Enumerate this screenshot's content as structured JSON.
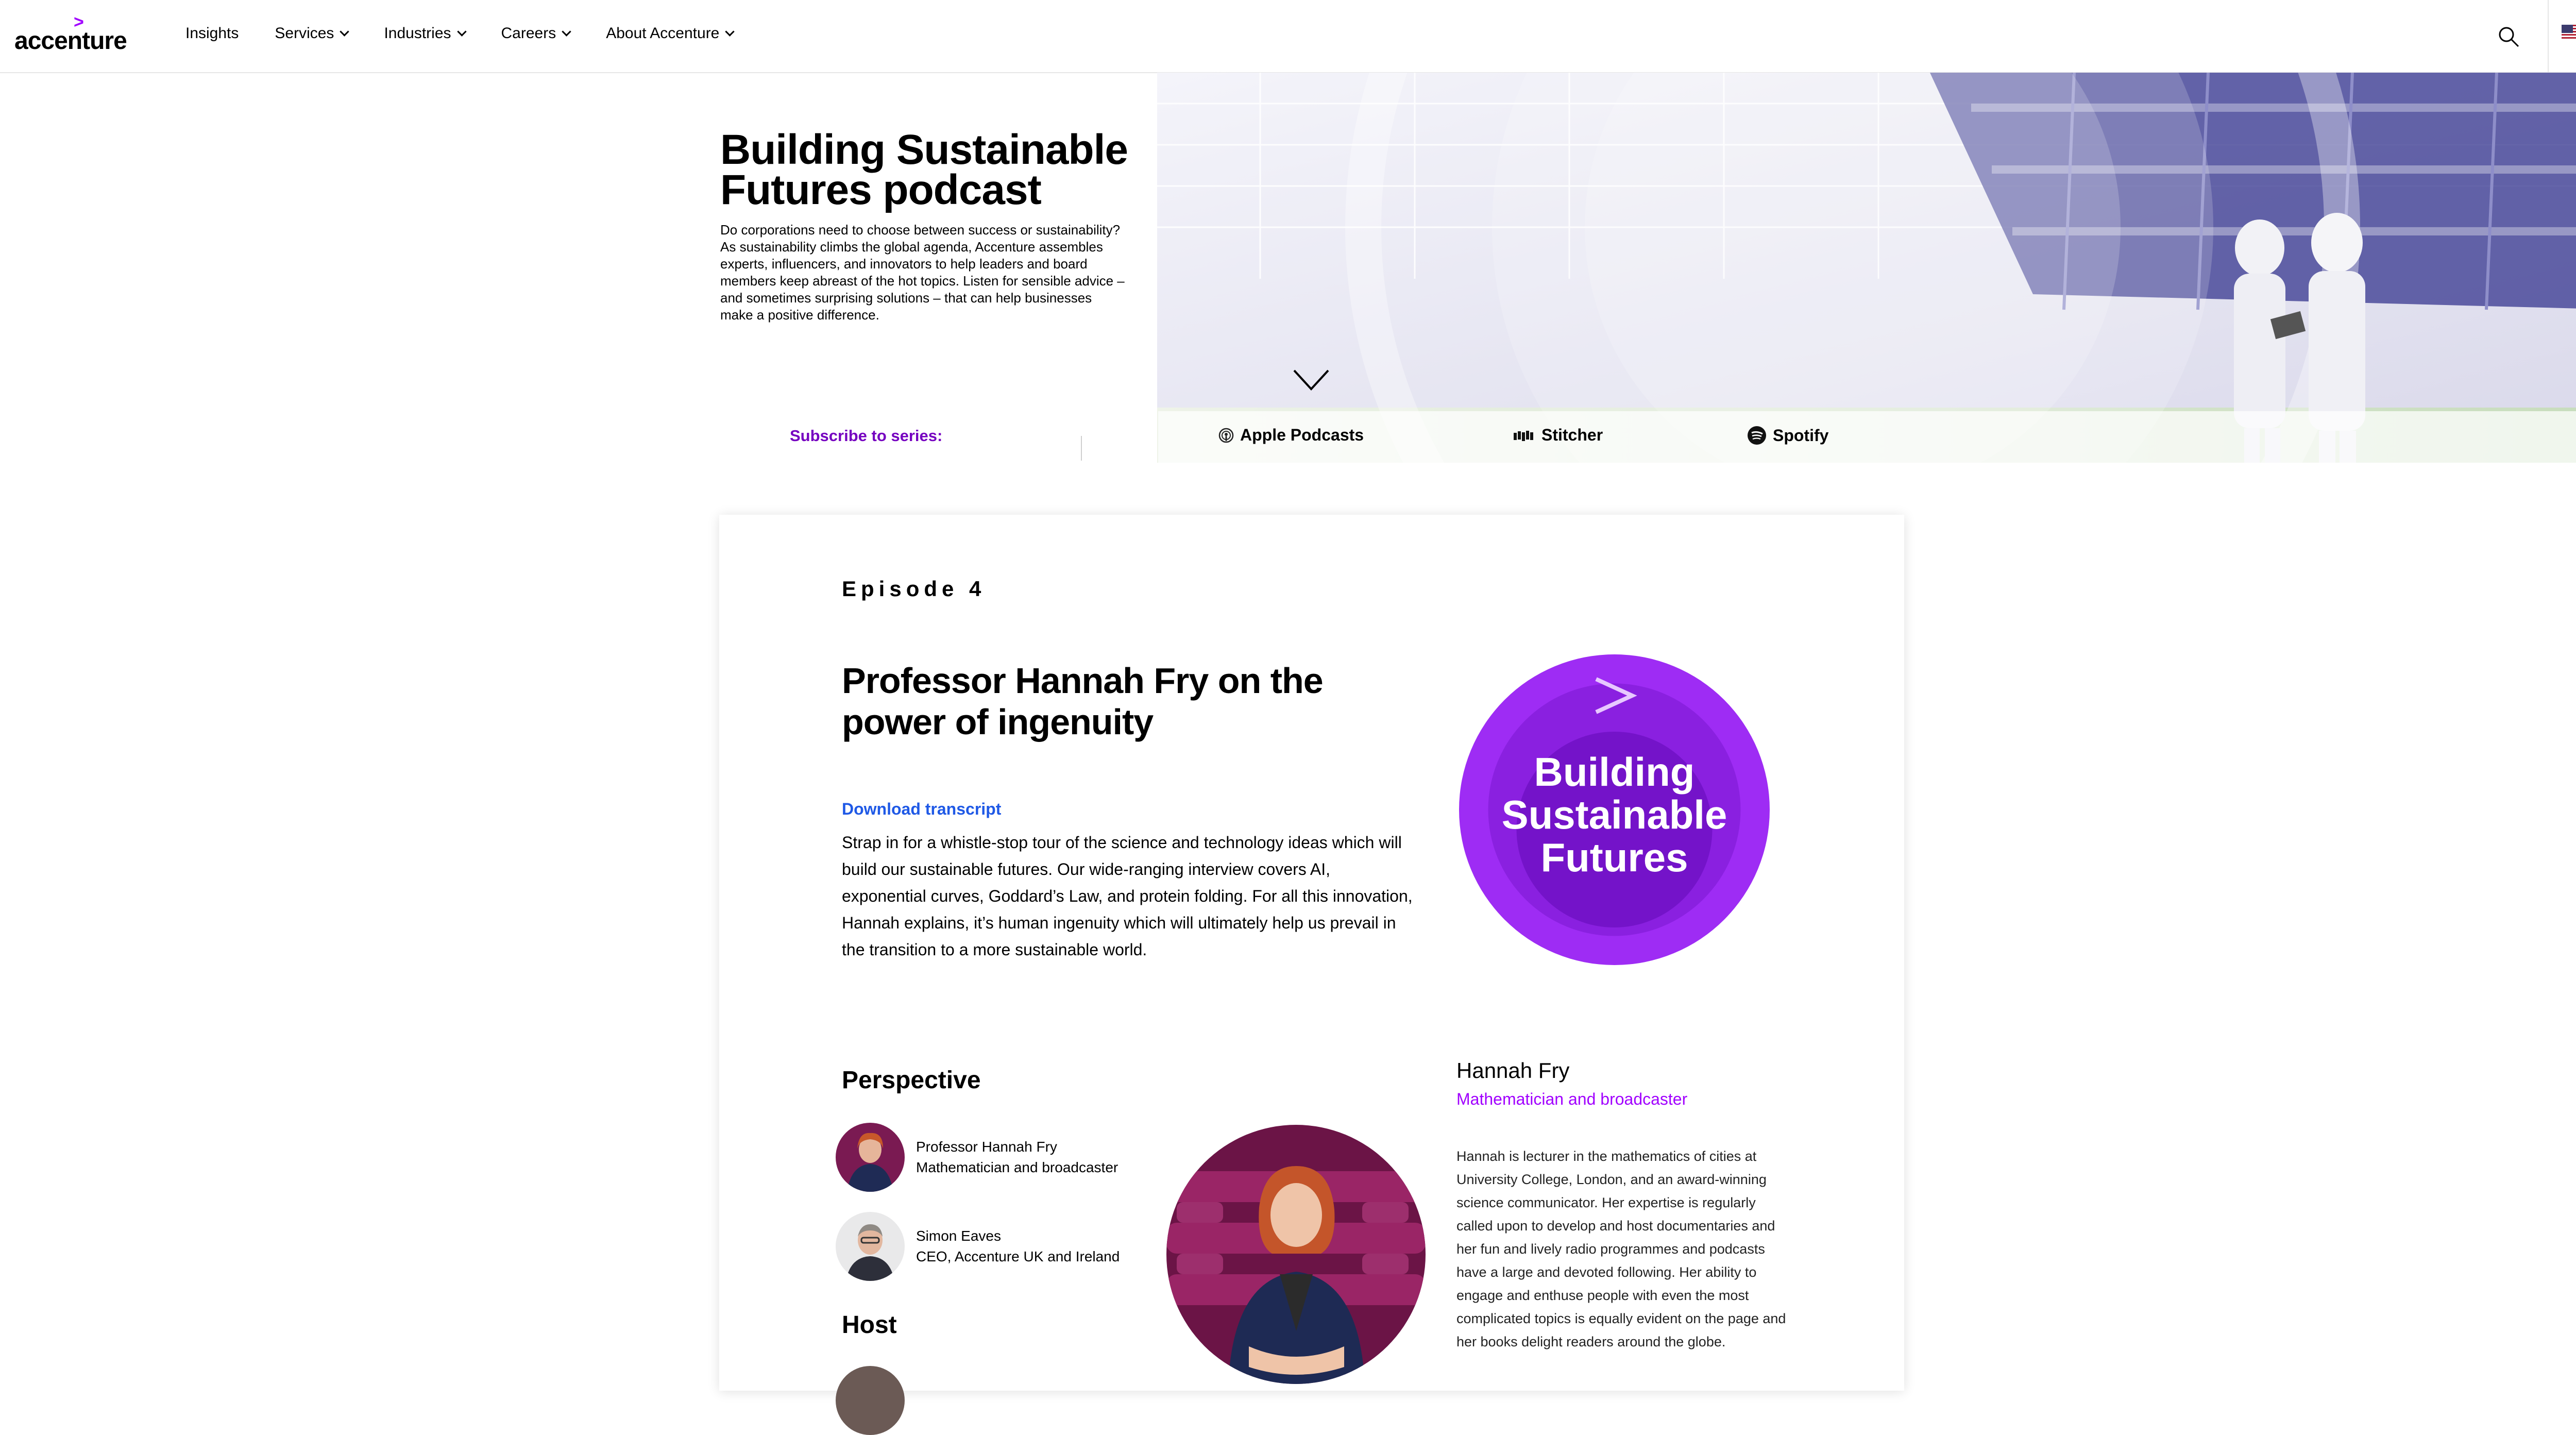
{
  "nav": {
    "logo_mark": ">",
    "logo_text": "accenture",
    "items": [
      "Insights",
      "Services",
      "Industries",
      "Careers",
      "About Accenture"
    ]
  },
  "hero": {
    "title": "Building Sustainable Futures podcast",
    "description": "Do corporations need to choose between success or sustainability? As sustainability climbs the global agenda, Accenture assembles experts, influencers, and innovators to help leaders and board members keep abreast of the hot topics. Listen for sensible advice – and sometimes surprising solutions – that can help businesses make a positive difference."
  },
  "subscribe": {
    "label": "Subscribe to series:",
    "platforms": [
      "Apple Podcasts",
      "Stitcher",
      "Spotify"
    ]
  },
  "episode": {
    "number": "Episode 4",
    "title": "Professor Hannah Fry on the power of ingenuity",
    "download_label": "Download transcript",
    "description": "Strap in for a whistle-stop tour of the science and technology ideas which will build our sustainable futures. Our wide-ranging interview covers AI, exponential curves, Goddard’s Law, and protein folding. For all this innovation, Hannah explains, it’s human ingenuity which will ultimately help us prevail in the transition to a more sustainable world.",
    "badge_lines": [
      "Building",
      "Sustainable",
      "Futures"
    ]
  },
  "perspective": {
    "heading": "Perspective",
    "people": [
      {
        "name": "Professor Hannah Fry",
        "role": "Mathematician and broadcaster"
      },
      {
        "name": "Simon Eaves",
        "role": "CEO, Accenture UK and Ireland"
      }
    ]
  },
  "host": {
    "heading": "Host"
  },
  "bio": {
    "name": "Hannah Fry",
    "role": "Mathematician and broadcaster",
    "text": "Hannah is lecturer in the mathematics of cities at University College, London, and an award-winning science communicator. Her expertise is regularly called upon to develop and host documentaries and her fun and lively radio programmes and podcasts have a large and devoted following. Her ability to engage and enthuse people with even the most complicated topics is equally evident on the page and her books delight readers around the globe."
  },
  "colors": {
    "accent_purple": "#a100ff",
    "subscribe_purple": "#7500c0",
    "link_blue": "#1f59e6"
  }
}
